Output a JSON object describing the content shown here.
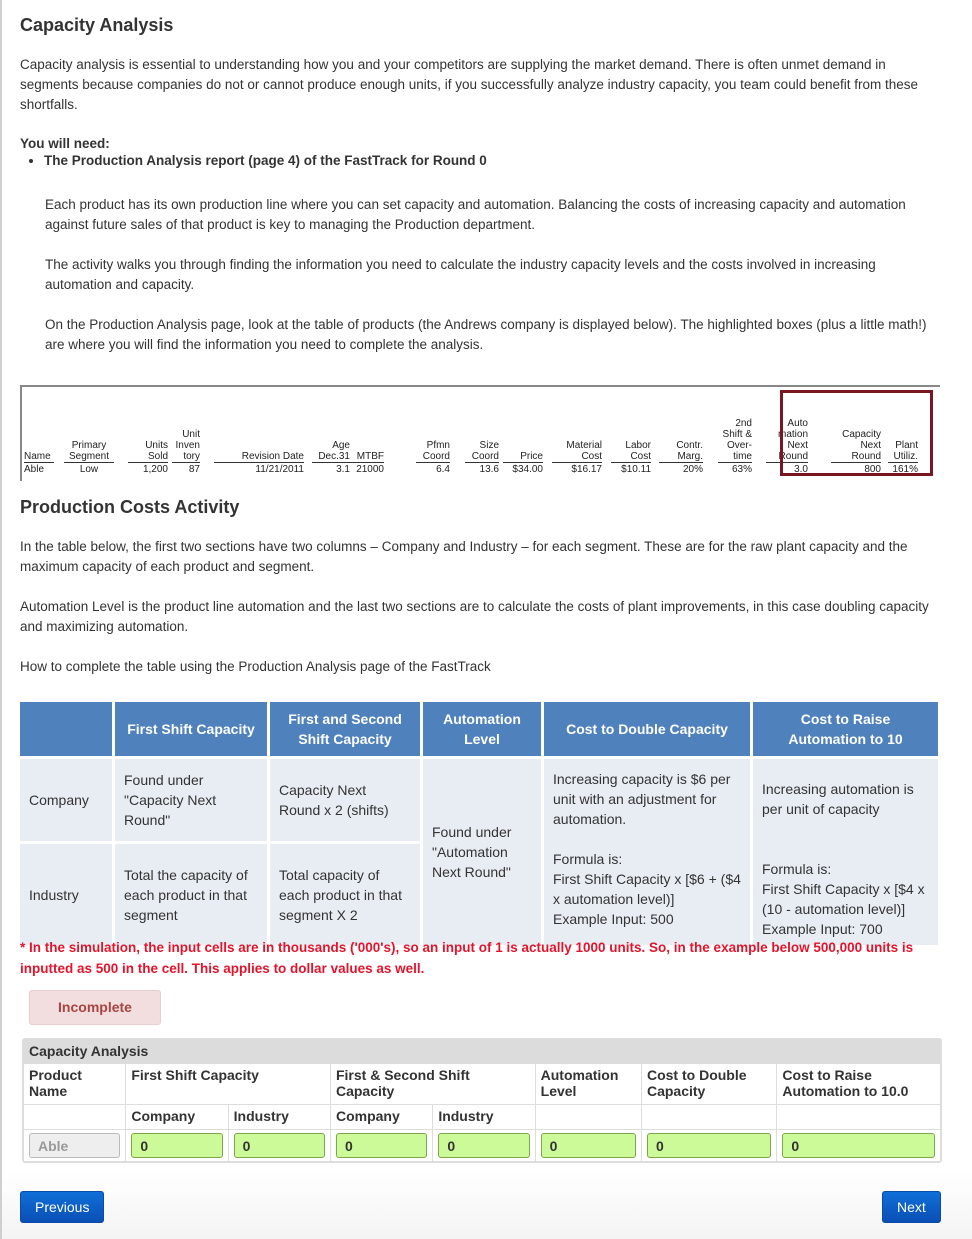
{
  "title": "Capacity Analysis",
  "intro": "Capacity analysis is essential to understanding how you and your competitors are supplying the market demand. There is often unmet demand in segments because companies do not or cannot produce enough units, if you successfully analyze industry capacity, you team could benefit from these shortfalls.",
  "need_label": "You will need:",
  "need_item": "The Production Analysis report (page 4) of the FastTrack for Round 0",
  "para1": "Each product has its own production line where you can set capacity and automation. Balancing the costs of increasing capacity and automation against future sales of that product is key to managing the Production department.",
  "para2": "The activity walks you through finding the information you need to calculate the industry capacity levels and the costs involved in increasing automation and capacity.",
  "para3": "On the Production Analysis page, look at the table of products (the Andrews company is displayed below). The highlighted boxes (plus a little math!) are where you will find the information you need to complete the analysis.",
  "report": {
    "headers": [
      "Name",
      "Primary Segment",
      "Units Sold",
      "Unit Inven tory",
      "Revision Date",
      "Age Dec.31",
      "MTBF",
      "Pfmn Coord",
      "Size Coord",
      "Price",
      "Material Cost",
      "Labor Cost",
      "Contr. Marg.",
      "2nd Shift & Over- time",
      "Auto mation Next Round",
      "Capacity Next Round",
      "Plant Utiliz."
    ],
    "row": [
      "Able",
      "Low",
      "1,200",
      "87",
      "11/21/2011",
      "3.1",
      "21000",
      "6.4",
      "13.6",
      "$34.00",
      "$16.17",
      "$10.11",
      "20%",
      "63%",
      "3.0",
      "800",
      "161%"
    ]
  },
  "section2_title": "Production Costs Activity",
  "para4": "In the table below, the first two sections have two columns – Company and Industry – for each segment. These are for the raw plant capacity and the maximum capacity of each product and segment.",
  "para5": "Automation Level is the product line automation and the last two sections are to calculate the costs of plant improvements, in this case doubling capacity and maximizing automation.",
  "para6": "How to complete the table using the Production Analysis page of the FastTrack",
  "guide": {
    "headers": [
      "First Shift Capacity",
      "First and Second Shift Capacity",
      "Automation Level",
      "Cost to Double Capacity",
      "Cost to Raise Automation to 10"
    ],
    "company_label": "Company",
    "industry_label": "Industry",
    "company_first": "Found under \"Capacity Next Round\"",
    "company_second": "Capacity Next Round x 2 (shifts)",
    "automation": "Found under \"Automation Next Round\"",
    "double_desc": "Increasing capacity is $6 per unit with an adjustment for automation.",
    "double_formula": "Formula is:",
    "double_formula_text": "First Shift Capacity x [$6  + ($4 x automation level)]",
    "double_example": "Example Input: 500",
    "raise_desc": "Increasing automation is per unit of capacity",
    "raise_formula": "Formula is:",
    "raise_formula_text": "First Shift Capacity x [$4 x (10 - automation level)]",
    "raise_example": "Example Input: 700",
    "industry_first": "Total the capacity of each product in that segment",
    "industry_second": "Total capacity of each product in that segment X 2"
  },
  "note": "* In the simulation, the input cells are in thousands ('000's), so an input of 1 is actually 1000 units. So, in the example below 500,000 units is inputted as 500 in the cell. This applies to dollar values as well.",
  "status": "Incomplete",
  "grid": {
    "caption": "Capacity Analysis",
    "headers": [
      "Product Name",
      "First Shift Capacity",
      "First & Second Shift Capacity",
      "Automation Level",
      "Cost to Double Capacity",
      "Cost to Raise Automation to 10.0"
    ],
    "sub": [
      "Company",
      "Industry",
      "Company",
      "Industry"
    ],
    "product": "Able",
    "values": [
      "0",
      "0",
      "0",
      "0",
      "0",
      "0",
      "0"
    ]
  },
  "nav": {
    "previous": "Previous",
    "next": "Next"
  }
}
